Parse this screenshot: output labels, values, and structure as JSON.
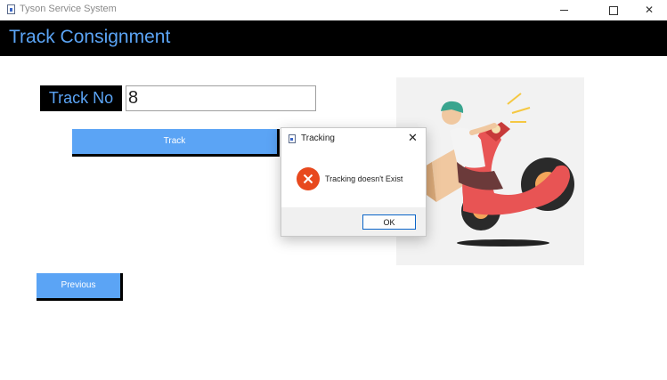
{
  "window": {
    "title": "Tyson Service System"
  },
  "header": {
    "title": "Track Consignment"
  },
  "form": {
    "track_no_label": "Track No",
    "track_no_value": "8",
    "track_button": "Track",
    "previous_button": "Previous"
  },
  "dialog": {
    "title": "Tracking",
    "message": "Tracking doesn't Exist",
    "ok_button": "OK",
    "icon": "error-icon"
  },
  "colors": {
    "accent": "#5ba4f5",
    "header_bg": "#000000",
    "error": "#e8491e"
  }
}
